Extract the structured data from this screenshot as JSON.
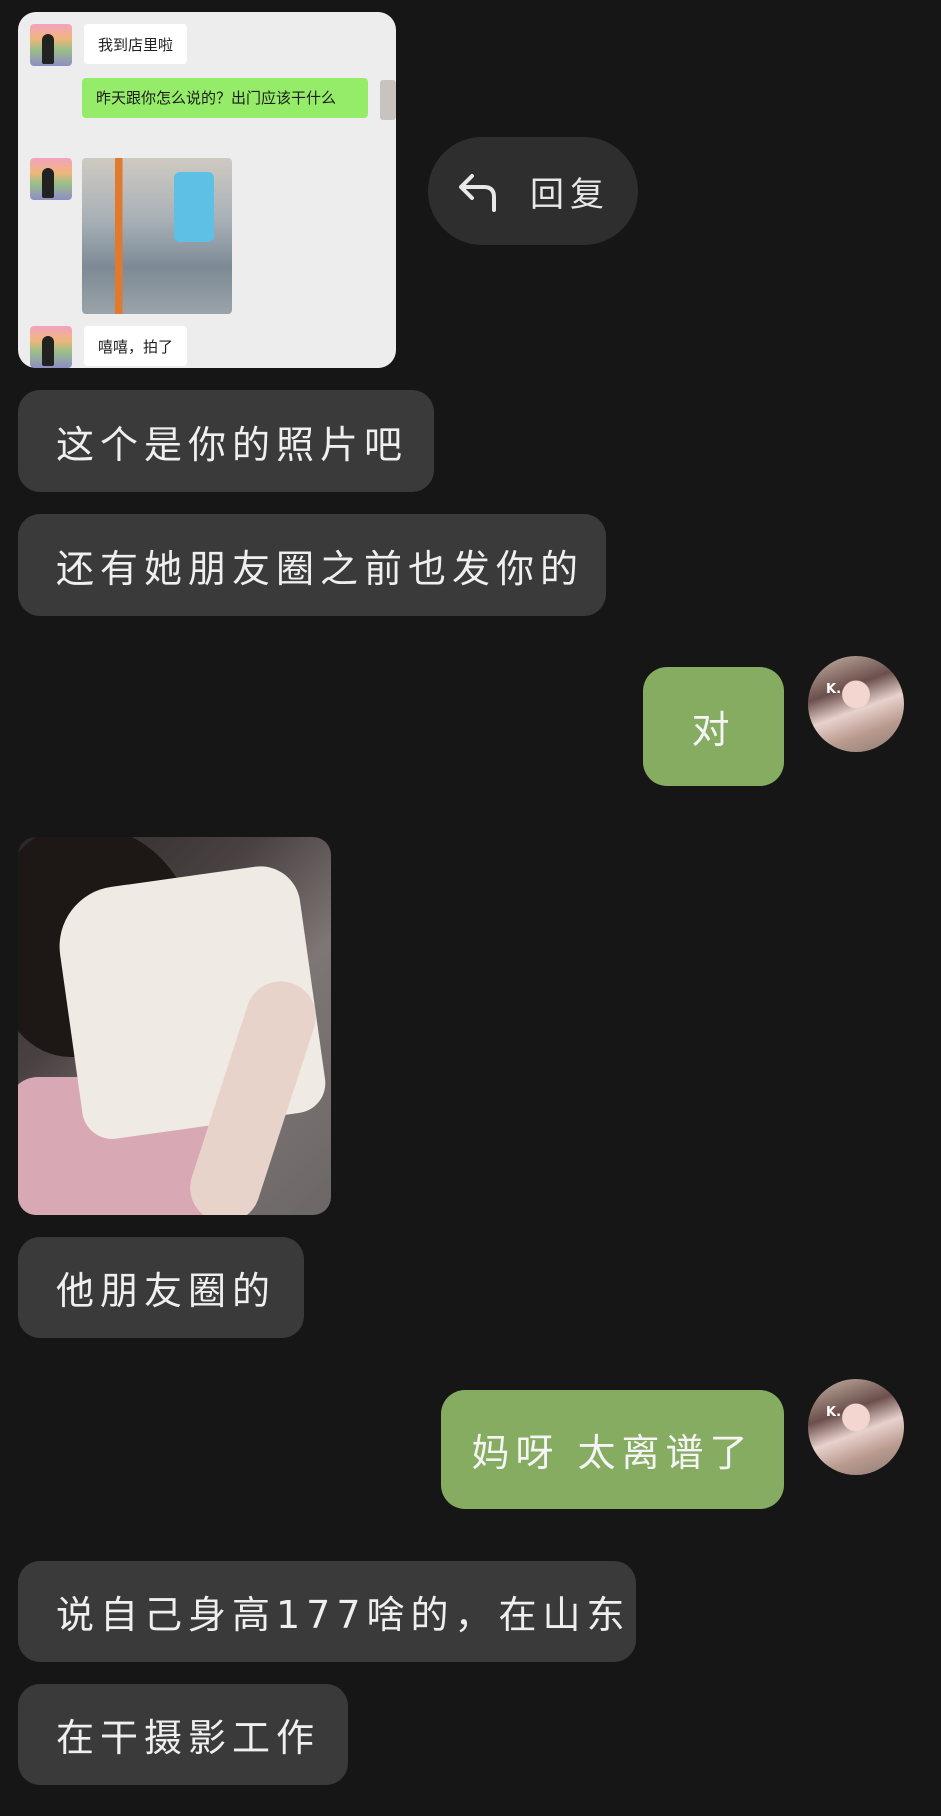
{
  "quoted_card": {
    "msg1": "我到店里啦",
    "msg2": "昨天跟你怎么说的？出门应该干什么",
    "msg3": "嘻嘻，拍了"
  },
  "reply_action": {
    "icon": "reply-arrow-icon",
    "label": "回复"
  },
  "messages": {
    "m1": "这个是你的照片吧",
    "m2": "还有她朋友圈之前也发你的",
    "m3": "对",
    "m4": "他朋友圈的",
    "m5": "妈呀 太离谱了",
    "m6": "说自己身高177啥的，在山东",
    "m7": "在干摄影工作"
  },
  "avatar_tag": "K.",
  "colors": {
    "background": "#161616",
    "incoming_bubble": "#3a3a3a",
    "outgoing_bubble": "#86ac61",
    "quoted_card_bg": "#ededed",
    "quoted_green": "#95ec69"
  }
}
